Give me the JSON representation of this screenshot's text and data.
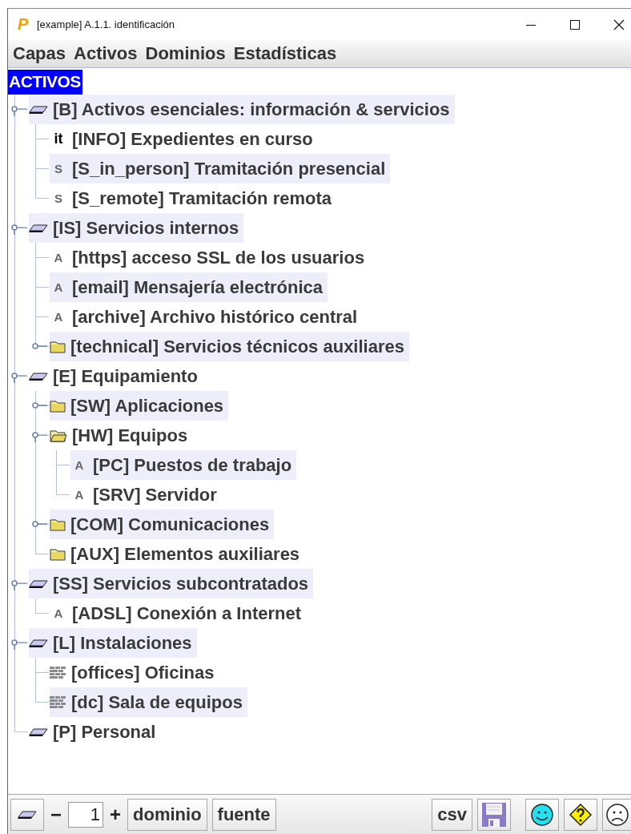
{
  "window": {
    "logo": "P",
    "title": "[example] A.1.1. identificación"
  },
  "menu": [
    "Capas",
    "Activos",
    "Dominios",
    "Estadísticas"
  ],
  "tree": {
    "title": "ACTIVOS",
    "items": [
      {
        "kind": "layer",
        "label": "[B] Activos esenciales: información & servicios",
        "expanded": true,
        "children": [
          {
            "kind": "tag",
            "badge": "it",
            "label": "[INFO] Expedientes en curso"
          },
          {
            "kind": "letter",
            "badge": "S",
            "label": "[S_in_person] Tramitación presencial"
          },
          {
            "kind": "letter",
            "badge": "S",
            "label": "[S_remote] Tramitación remota"
          }
        ]
      },
      {
        "kind": "layer",
        "label": "[IS] Servicios internos",
        "expanded": true,
        "children": [
          {
            "kind": "letter",
            "badge": "A",
            "label": "[https] acceso SSL de los usuarios"
          },
          {
            "kind": "letter",
            "badge": "A",
            "label": "[email] Mensajería electrónica"
          },
          {
            "kind": "letter",
            "badge": "A",
            "label": "[archive] Archivo histórico central"
          },
          {
            "kind": "folder",
            "label": "[technical] Servicios técnicos auxiliares",
            "expanded": false
          }
        ]
      },
      {
        "kind": "layer",
        "label": "[E] Equipamiento",
        "expanded": true,
        "children": [
          {
            "kind": "folder",
            "label": "[SW] Aplicaciones",
            "expanded": false
          },
          {
            "kind": "folder_open",
            "label": "[HW] Equipos",
            "expanded": true,
            "children": [
              {
                "kind": "letter",
                "badge": "A",
                "label": "[PC] Puestos de trabajo"
              },
              {
                "kind": "letter",
                "badge": "A",
                "label": "[SRV] Servidor"
              }
            ]
          },
          {
            "kind": "folder",
            "label": "[COM] Comunicaciones",
            "expanded": false
          },
          {
            "kind": "folder",
            "label": "[AUX] Elementos auxiliares"
          }
        ]
      },
      {
        "kind": "layer",
        "label": "[SS] Servicios subcontratados",
        "expanded": true,
        "children": [
          {
            "kind": "letter",
            "badge": "A",
            "label": "[ADSL] Conexión a Internet"
          }
        ]
      },
      {
        "kind": "layer",
        "label": "[L] Instalaciones",
        "expanded": true,
        "children": [
          {
            "kind": "brick",
            "label": "[offices] Oficinas"
          },
          {
            "kind": "brick",
            "label": "[dc] Sala de equipos"
          }
        ]
      },
      {
        "kind": "layer",
        "label": "[P] Personal"
      }
    ]
  },
  "toolbar": {
    "decrement": "−",
    "value": "1",
    "increment": "+",
    "buttons": [
      "dominio",
      "fuente"
    ],
    "csv": "csv"
  }
}
